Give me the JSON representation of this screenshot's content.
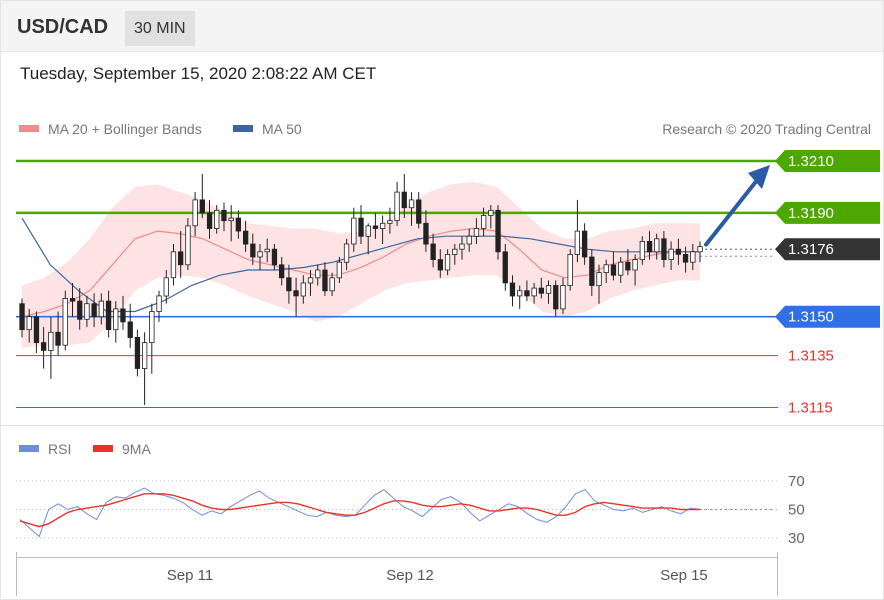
{
  "header": {
    "pair": "USD/CAD",
    "timeframe": "30 MIN"
  },
  "timestamp": "Tuesday, September 15, 2020 2:08:22 AM CET",
  "legend": {
    "main": [
      "MA 20 + Bollinger Bands",
      "MA 50"
    ],
    "rsi": [
      "RSI",
      "9MA"
    ]
  },
  "copyright": "Research © 2020 Trading Central",
  "colors": {
    "support": "#2f6fe8",
    "resistance": "#4ca800",
    "target_red": "#e8332b",
    "current": "#333333",
    "up_candle": "#ffffff",
    "down_candle": "#222222",
    "bollinger": "#fcd9d9",
    "ma20": "#f28a8a",
    "ma50": "#3c64a0",
    "rsi": "#6d8de0",
    "rsi_ma": "#e8332b",
    "arrow": "#2a5aa8"
  },
  "chart_data": [
    {
      "type": "candlestick",
      "symbol": "USD/CAD",
      "timeframe": "30 MIN",
      "x_ticks": [
        "Sep 11",
        "Sep 12",
        "Sep 15"
      ],
      "ylim": [
        1.311,
        1.3212
      ],
      "key_levels": [
        {
          "label": "1.3210",
          "value": 1.321,
          "kind": "resistance"
        },
        {
          "label": "1.3190",
          "value": 1.319,
          "kind": "resistance"
        },
        {
          "label": "1.3176",
          "value": 1.3176,
          "kind": "current"
        },
        {
          "label": "1.3150",
          "value": 1.315,
          "kind": "support"
        },
        {
          "label": "1.3135",
          "value": 1.3135,
          "kind": "target"
        },
        {
          "label": "1.3115",
          "value": 1.3115,
          "kind": "target"
        }
      ],
      "candles_ohlc": [
        [
          1.3155,
          1.3157,
          1.3142,
          1.3145
        ],
        [
          1.3145,
          1.3153,
          1.314,
          1.315
        ],
        [
          1.315,
          1.3152,
          1.3136,
          1.314
        ],
        [
          1.314,
          1.3146,
          1.313,
          1.3137
        ],
        [
          1.3137,
          1.315,
          1.3126,
          1.3144
        ],
        [
          1.3144,
          1.3152,
          1.3135,
          1.3139
        ],
        [
          1.3139,
          1.316,
          1.3137,
          1.3157
        ],
        [
          1.3157,
          1.3163,
          1.315,
          1.3156
        ],
        [
          1.3156,
          1.3161,
          1.3145,
          1.3149
        ],
        [
          1.3149,
          1.3158,
          1.3146,
          1.3155
        ],
        [
          1.3155,
          1.3159,
          1.3146,
          1.315
        ],
        [
          1.315,
          1.3159,
          1.3147,
          1.3156
        ],
        [
          1.3156,
          1.316,
          1.3142,
          1.3145
        ],
        [
          1.3145,
          1.3156,
          1.314,
          1.3153
        ],
        [
          1.3153,
          1.3158,
          1.3145,
          1.3148
        ],
        [
          1.3148,
          1.3155,
          1.3138,
          1.3142
        ],
        [
          1.3142,
          1.3145,
          1.3127,
          1.313
        ],
        [
          1.313,
          1.3144,
          1.3116,
          1.314
        ],
        [
          1.314,
          1.3155,
          1.3128,
          1.3152
        ],
        [
          1.3152,
          1.316,
          1.3148,
          1.3158
        ],
        [
          1.3158,
          1.3168,
          1.3155,
          1.3165
        ],
        [
          1.3165,
          1.3178,
          1.3162,
          1.3175
        ],
        [
          1.3175,
          1.3183,
          1.3165,
          1.317
        ],
        [
          1.317,
          1.3188,
          1.3168,
          1.3185
        ],
        [
          1.3185,
          1.3198,
          1.3181,
          1.3195
        ],
        [
          1.3195,
          1.3205,
          1.3188,
          1.319
        ],
        [
          1.319,
          1.3195,
          1.318,
          1.3184
        ],
        [
          1.3184,
          1.3193,
          1.3182,
          1.3191
        ],
        [
          1.3191,
          1.3194,
          1.3183,
          1.3187
        ],
        [
          1.3187,
          1.3193,
          1.3179,
          1.3188
        ],
        [
          1.3188,
          1.3191,
          1.318,
          1.3183
        ],
        [
          1.3183,
          1.3187,
          1.3175,
          1.3178
        ],
        [
          1.3178,
          1.3182,
          1.317,
          1.3173
        ],
        [
          1.3173,
          1.3178,
          1.3168,
          1.3175
        ],
        [
          1.3175,
          1.318,
          1.3171,
          1.3176
        ],
        [
          1.3176,
          1.3178,
          1.3168,
          1.317
        ],
        [
          1.317,
          1.3173,
          1.3162,
          1.3165
        ],
        [
          1.3165,
          1.317,
          1.3155,
          1.316
        ],
        [
          1.316,
          1.3165,
          1.315,
          1.3158
        ],
        [
          1.3158,
          1.3166,
          1.3155,
          1.3163
        ],
        [
          1.3163,
          1.3168,
          1.3158,
          1.3165
        ],
        [
          1.3165,
          1.317,
          1.3162,
          1.3168
        ],
        [
          1.3168,
          1.3171,
          1.3158,
          1.316
        ],
        [
          1.316,
          1.3167,
          1.3158,
          1.3165
        ],
        [
          1.3165,
          1.3173,
          1.3163,
          1.3171
        ],
        [
          1.3171,
          1.318,
          1.3168,
          1.3178
        ],
        [
          1.3178,
          1.3192,
          1.3175,
          1.3188
        ],
        [
          1.3188,
          1.3193,
          1.3178,
          1.3181
        ],
        [
          1.3181,
          1.3186,
          1.3174,
          1.3185
        ],
        [
          1.3185,
          1.319,
          1.318,
          1.3184
        ],
        [
          1.3184,
          1.3189,
          1.3178,
          1.3186
        ],
        [
          1.3186,
          1.3192,
          1.3182,
          1.3187
        ],
        [
          1.3187,
          1.3202,
          1.3185,
          1.3198
        ],
        [
          1.3198,
          1.3205,
          1.3188,
          1.3192
        ],
        [
          1.3192,
          1.3198,
          1.3185,
          1.3195
        ],
        [
          1.3195,
          1.3198,
          1.3184,
          1.3186
        ],
        [
          1.3186,
          1.3191,
          1.3175,
          1.3178
        ],
        [
          1.3178,
          1.3182,
          1.3169,
          1.3172
        ],
        [
          1.3172,
          1.3176,
          1.3165,
          1.3168
        ],
        [
          1.3168,
          1.3176,
          1.3166,
          1.3174
        ],
        [
          1.3174,
          1.3178,
          1.317,
          1.3176
        ],
        [
          1.3176,
          1.3181,
          1.3172,
          1.3178
        ],
        [
          1.3178,
          1.3184,
          1.3175,
          1.3181
        ],
        [
          1.3181,
          1.3188,
          1.3178,
          1.3184
        ],
        [
          1.3184,
          1.3192,
          1.3181,
          1.3189
        ],
        [
          1.3189,
          1.3193,
          1.3184,
          1.3191
        ],
        [
          1.3191,
          1.3193,
          1.3172,
          1.3175
        ],
        [
          1.3175,
          1.3178,
          1.316,
          1.3163
        ],
        [
          1.3163,
          1.3166,
          1.3154,
          1.3158
        ],
        [
          1.3158,
          1.3162,
          1.3153,
          1.316
        ],
        [
          1.316,
          1.3164,
          1.3156,
          1.3158
        ],
        [
          1.3158,
          1.3163,
          1.3155,
          1.3161
        ],
        [
          1.3161,
          1.3165,
          1.3157,
          1.3159
        ],
        [
          1.3159,
          1.3164,
          1.3155,
          1.3162
        ],
        [
          1.3162,
          1.3164,
          1.315,
          1.3153
        ],
        [
          1.3153,
          1.3165,
          1.3151,
          1.3162
        ],
        [
          1.3162,
          1.3176,
          1.316,
          1.3174
        ],
        [
          1.3174,
          1.3195,
          1.3171,
          1.3183
        ],
        [
          1.3183,
          1.3186,
          1.317,
          1.3173
        ],
        [
          1.3173,
          1.3176,
          1.3158,
          1.3162
        ],
        [
          1.3162,
          1.317,
          1.3155,
          1.3167
        ],
        [
          1.3167,
          1.3172,
          1.3163,
          1.317
        ],
        [
          1.317,
          1.3175,
          1.3164,
          1.3166
        ],
        [
          1.3166,
          1.3173,
          1.3163,
          1.3171
        ],
        [
          1.3171,
          1.3176,
          1.3166,
          1.3168
        ],
        [
          1.3168,
          1.3174,
          1.3162,
          1.3172
        ],
        [
          1.3172,
          1.3181,
          1.317,
          1.3179
        ],
        [
          1.3179,
          1.3183,
          1.3172,
          1.3175
        ],
        [
          1.3175,
          1.3182,
          1.3172,
          1.318
        ],
        [
          1.318,
          1.3183,
          1.3169,
          1.3172
        ],
        [
          1.3172,
          1.3179,
          1.3168,
          1.3176
        ],
        [
          1.3176,
          1.318,
          1.317,
          1.3174
        ],
        [
          1.3174,
          1.3177,
          1.3167,
          1.3171
        ],
        [
          1.3171,
          1.3178,
          1.3168,
          1.3175
        ],
        [
          1.3175,
          1.3179,
          1.3171,
          1.3177
        ]
      ],
      "ma20": [
        1.315,
        1.3152,
        1.3155,
        1.316,
        1.317,
        1.318,
        1.3183,
        1.3182,
        1.318,
        1.3176,
        1.3172,
        1.317,
        1.3168,
        1.3166,
        1.3166,
        1.3169,
        1.3173,
        1.3178,
        1.3181,
        1.3183,
        1.3184,
        1.3183,
        1.3176,
        1.3168,
        1.3165,
        1.3166,
        1.317,
        1.3172,
        1.3174,
        1.3175,
        1.3175
      ],
      "ma50": [
        1.3188,
        1.317,
        1.316,
        1.3152,
        1.3152,
        1.3156,
        1.3162,
        1.3166,
        1.3168,
        1.3168,
        1.3169,
        1.3171,
        1.3174,
        1.3177,
        1.318,
        1.3181,
        1.3181,
        1.3181,
        1.318,
        1.3178,
        1.3176,
        1.3175,
        1.3175,
        1.3175,
        1.3175
      ]
    },
    {
      "type": "line",
      "title": "RSI",
      "y_ticks": [
        30,
        50,
        70
      ],
      "series": [
        {
          "name": "RSI",
          "values": [
            43,
            37,
            31,
            50,
            54,
            50,
            52,
            47,
            43,
            55,
            59,
            58,
            62,
            65,
            61,
            60,
            58,
            55,
            50,
            46,
            49,
            47,
            52,
            56,
            60,
            63,
            58,
            55,
            52,
            49,
            46,
            45,
            48,
            46,
            45,
            46,
            53,
            60,
            64,
            58,
            52,
            49,
            45,
            51,
            57,
            59,
            55,
            48,
            42,
            46,
            50,
            54,
            52,
            47,
            43,
            41,
            45,
            52,
            61,
            64,
            56,
            53,
            50,
            49,
            51,
            48,
            50,
            52,
            49,
            47,
            51,
            50
          ]
        },
        {
          "name": "9MA",
          "values": [
            42,
            40,
            38,
            40,
            44,
            48,
            50,
            51,
            52,
            53,
            55,
            57,
            59,
            61,
            61,
            61,
            60,
            58,
            56,
            53,
            51,
            50,
            50,
            51,
            52,
            53,
            54,
            55,
            55,
            54,
            52,
            50,
            48,
            47,
            46,
            46,
            48,
            51,
            54,
            56,
            56,
            55,
            53,
            52,
            52,
            53,
            54,
            53,
            51,
            49,
            49,
            50,
            51,
            51,
            50,
            48,
            46,
            46,
            48,
            52,
            54,
            55,
            54,
            53,
            52,
            51,
            51,
            51,
            51,
            50,
            50,
            50
          ]
        }
      ]
    }
  ]
}
